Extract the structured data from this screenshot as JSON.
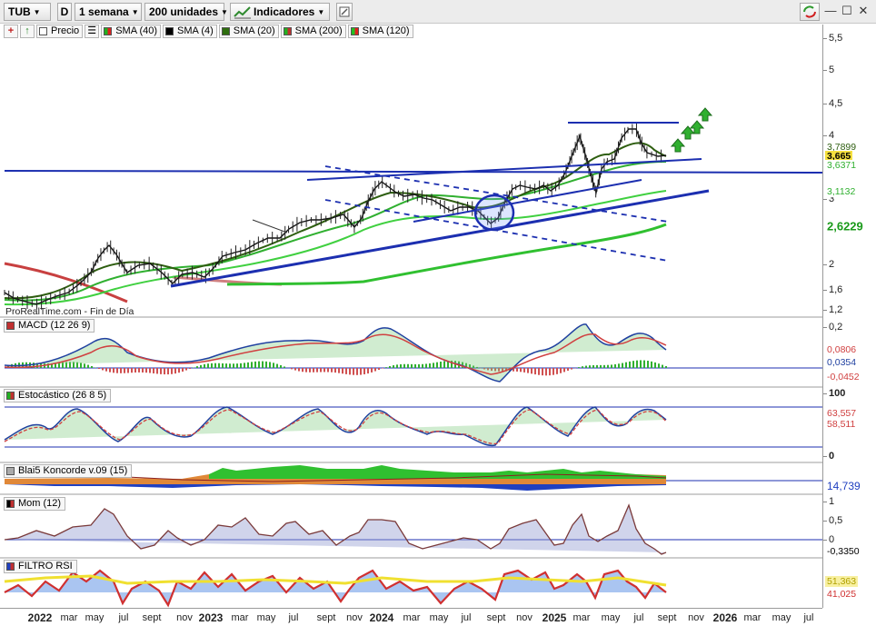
{
  "toolbar": {
    "symbol": "TUB",
    "period_label": "D",
    "timeframe": "1 semana",
    "units": "200 unidades",
    "indicators": "Indicadores"
  },
  "legend": [
    {
      "label": "Precio",
      "color": "#ffffff"
    },
    {
      "label": "SMA (40)",
      "color": "#e02020"
    },
    {
      "label": "SMA (4)",
      "color": "#000000"
    },
    {
      "label": "SMA (20)",
      "color": "#2e6e0e"
    },
    {
      "label": "SMA (200)",
      "color": "#c03030"
    },
    {
      "label": "SMA (120)",
      "color": "#22c022"
    }
  ],
  "source": "ProRealTime.com - Fin de Día",
  "panels": {
    "macd": {
      "label": "MACD (12 26 9)",
      "color": "#c03030"
    },
    "stoch": {
      "label": "Estocástico (26 8 5)",
      "color": "#c03030"
    },
    "koncorde": {
      "label": "Blai5 Koncorde v.09 (15)",
      "color": "#aaaaaa"
    },
    "mom": {
      "label": "Mom (12)",
      "color": "#000000"
    },
    "rsi": {
      "label": "FILTRO RSI",
      "color": "#c03030"
    }
  },
  "price_axis": {
    "ticks": [
      "5,5",
      "5",
      "4,5",
      "4",
      "3",
      "2",
      "1,6",
      "1,2"
    ],
    "badges": [
      "3,7899",
      "3,665",
      "3,6371",
      "3,1132",
      "2,6229"
    ]
  },
  "macd_axis": {
    "ticks": [
      "0,2"
    ],
    "badges": [
      "0,0806",
      "0,0354",
      "-0,0452"
    ]
  },
  "stoch_axis": {
    "ticks": [
      "100",
      "0"
    ],
    "badges": [
      "63,557",
      "58,511"
    ]
  },
  "koncorde_axis": {
    "badges": [
      "14,739"
    ]
  },
  "mom_axis": {
    "ticks": [
      "1",
      "0,5",
      "0"
    ],
    "badges": [
      "-0,3350"
    ]
  },
  "rsi_axis": {
    "badges": [
      "51,363",
      "41,025"
    ]
  },
  "dates": [
    "2022",
    "mar",
    "may",
    "jul",
    "sept",
    "nov",
    "2023",
    "mar",
    "may",
    "jul",
    "sept",
    "nov",
    "2024",
    "mar",
    "may",
    "jul",
    "sept",
    "nov",
    "2025",
    "mar",
    "may",
    "jul",
    "sept",
    "nov",
    "2026",
    "mar",
    "may",
    "jul"
  ],
  "chart_data": {
    "type": "candlestick",
    "price_series": {
      "x": [
        "2022-01",
        "2022-03",
        "2022-05",
        "2022-07",
        "2022-09",
        "2022-11",
        "2023-01",
        "2023-03",
        "2023-05",
        "2023-07",
        "2023-09",
        "2023-11",
        "2024-01",
        "2024-03",
        "2024-05",
        "2024-07",
        "2024-09",
        "2024-11",
        "2025-01",
        "2025-03",
        "2025-05",
        "2025-07",
        "2025-08"
      ],
      "close": [
        1.5,
        1.48,
        1.85,
        2.2,
        1.9,
        1.8,
        1.85,
        2.05,
        2.25,
        2.55,
        2.65,
        2.7,
        3.35,
        3.3,
        3.05,
        2.95,
        2.75,
        3.35,
        3.4,
        4.0,
        3.3,
        4.05,
        3.665
      ]
    },
    "last_values": {
      "close": 3.665,
      "sma20": 3.7899,
      "sma40": 3.6371,
      "sma120": 3.1132,
      "sma200": 2.6229
    },
    "ylim": [
      1.2,
      5.5
    ],
    "scale": "log",
    "macd_last": {
      "macd": 0.0806,
      "signal": 0.0354,
      "histogram": -0.0452
    },
    "stoch_last": {
      "k": 63.557,
      "d": 58.511
    },
    "koncorde_last": 14.739,
    "mom_last": -0.335,
    "rsi_last": {
      "a": 51.363,
      "b": 41.025
    }
  }
}
